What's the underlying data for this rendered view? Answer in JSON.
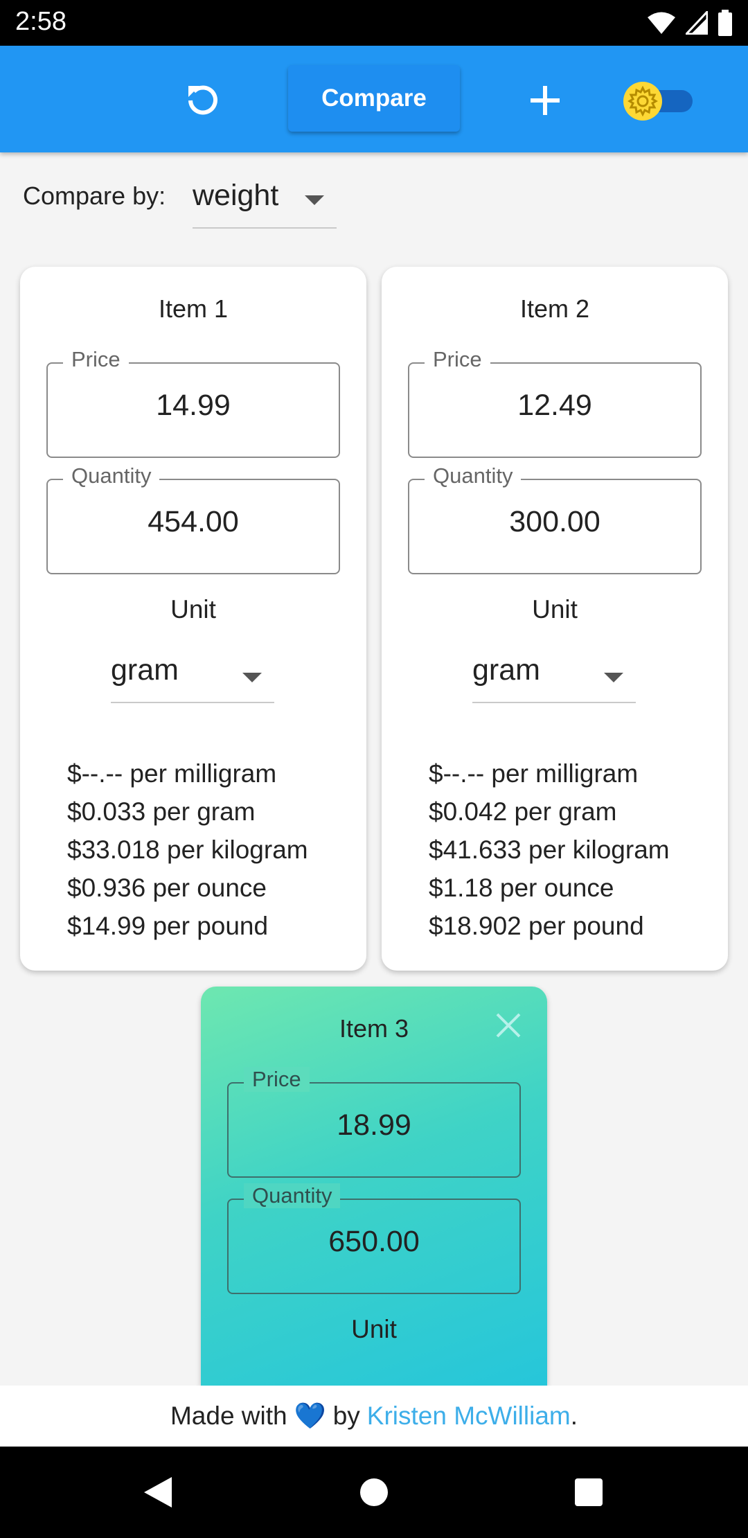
{
  "status_bar": {
    "time": "2:58"
  },
  "app_bar": {
    "compare_label": "Compare",
    "accent_color": "#2196f3",
    "theme_toggle_on": false
  },
  "compare_by": {
    "label": "Compare by:",
    "value": "weight"
  },
  "items": [
    {
      "title": "Item 1",
      "price_label": "Price",
      "price": "14.99",
      "quantity_label": "Quantity",
      "quantity": "454.00",
      "unit_label": "Unit",
      "unit": "gram",
      "prices": [
        "$--.-- per milligram",
        "$0.033 per gram",
        "$33.018 per kilogram",
        "$0.936 per ounce",
        "$14.99 per pound"
      ]
    },
    {
      "title": "Item 2",
      "price_label": "Price",
      "price": "12.49",
      "quantity_label": "Quantity",
      "quantity": "300.00",
      "unit_label": "Unit",
      "unit": "gram",
      "prices": [
        "$--.-- per milligram",
        "$0.042 per gram",
        "$41.633 per kilogram",
        "$1.18 per ounce",
        "$18.902 per pound"
      ]
    },
    {
      "title": "Item 3",
      "price_label": "Price",
      "price": "18.99",
      "quantity_label": "Quantity",
      "quantity": "650.00",
      "unit_label": "Unit",
      "highlight": true
    }
  ],
  "footer": {
    "prefix": "Made with",
    "heart": "💙",
    "by": "by",
    "author": "Kristen McWilliam",
    "suffix": "."
  }
}
